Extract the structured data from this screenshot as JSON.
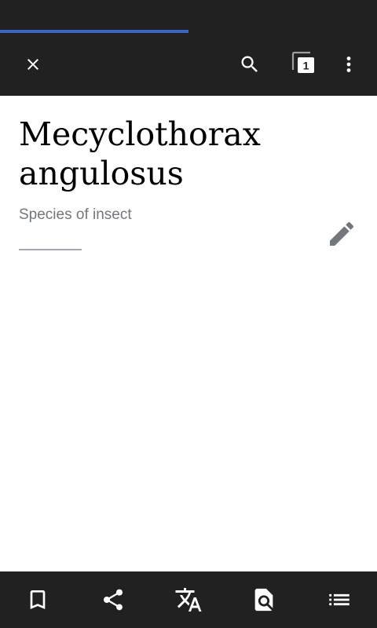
{
  "toolbar": {
    "tab_count": "1",
    "icons": [
      "close-icon",
      "search-icon",
      "tabs-icon",
      "more-vertical-icon"
    ]
  },
  "page_load_progress": 0.5,
  "article": {
    "title": "Mecyclothorax angulosus",
    "description": "Species of insect"
  },
  "bottom_bar": {
    "icons": [
      "bookmark-icon",
      "share-icon",
      "translate-icon",
      "find-in-page-icon",
      "contents-icon"
    ]
  },
  "colors": {
    "bar_background": "#212121",
    "progress": "#3b66c4",
    "description_text": "#72777d",
    "edit_icon": "#72777d",
    "divider": "#a2a9b1"
  }
}
